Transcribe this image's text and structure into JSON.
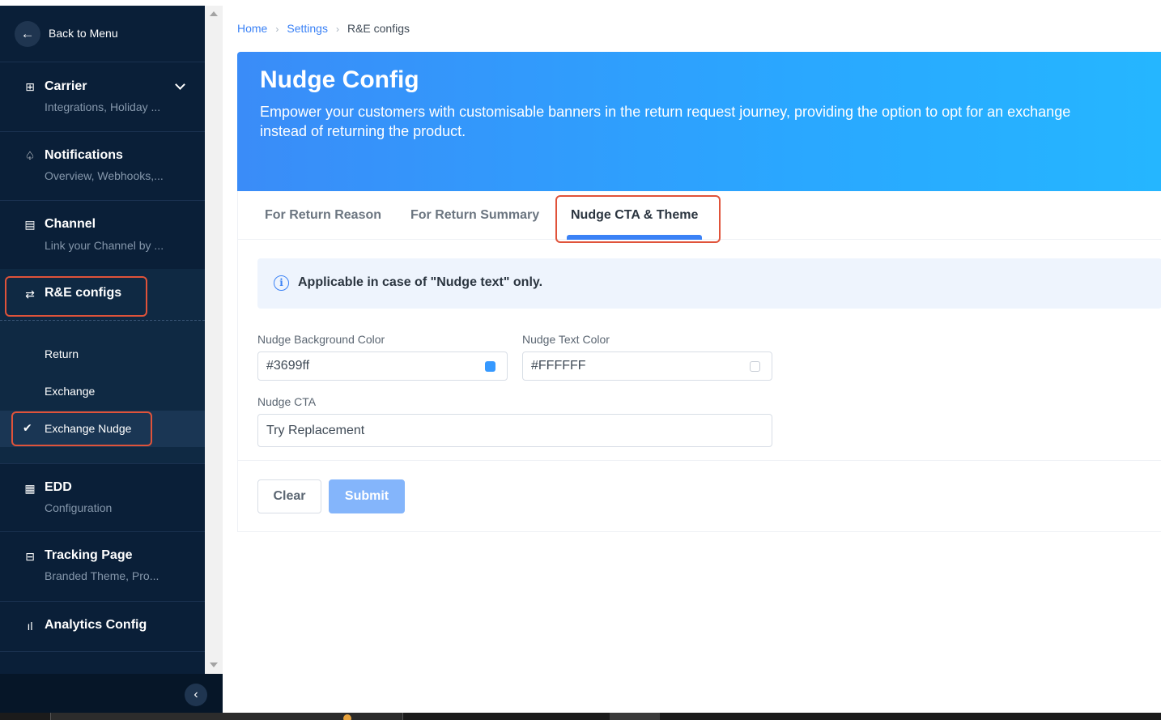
{
  "sidebar": {
    "back_label": "Back to Menu",
    "groups": [
      {
        "title": "Carrier",
        "subtitle": "Integrations, Holiday ..."
      },
      {
        "title": "Notifications",
        "subtitle": "Overview, Webhooks,..."
      },
      {
        "title": "Channel",
        "subtitle": "Link your Channel by ..."
      },
      {
        "title": "R&E configs",
        "subtitle": ""
      },
      {
        "title": "EDD",
        "subtitle": "Configuration"
      },
      {
        "title": "Tracking Page",
        "subtitle": "Branded Theme, Pro..."
      },
      {
        "title": "Analytics Config",
        "subtitle": ""
      }
    ],
    "re_items": [
      "Return",
      "Exchange",
      "Exchange Nudge"
    ]
  },
  "breadcrumb": {
    "home": "Home",
    "settings": "Settings",
    "current": "R&E configs"
  },
  "hero": {
    "title": "Nudge Config",
    "description": "Empower your customers with customisable banners in the return request journey, providing the option to opt for an exchange instead of returning the product."
  },
  "tabs": [
    "For Return Reason",
    "For Return Summary",
    "Nudge CTA & Theme"
  ],
  "info": {
    "text": "Applicable in case of \"Nudge text\" only."
  },
  "form": {
    "bg_color_label": "Nudge Background Color",
    "bg_color_value": "#3699ff",
    "text_color_label": "Nudge Text Color",
    "text_color_value": "#FFFFFF",
    "cta_label": "Nudge CTA",
    "cta_value": "Try Replacement"
  },
  "buttons": {
    "clear": "Clear",
    "submit": "Submit"
  },
  "colors": {
    "accent": "#3b82f6",
    "sidebar_bg": "#0a1f38",
    "highlight": "#e0533a",
    "swatch_bg": "#3699ff",
    "swatch_text": "#FFFFFF"
  }
}
